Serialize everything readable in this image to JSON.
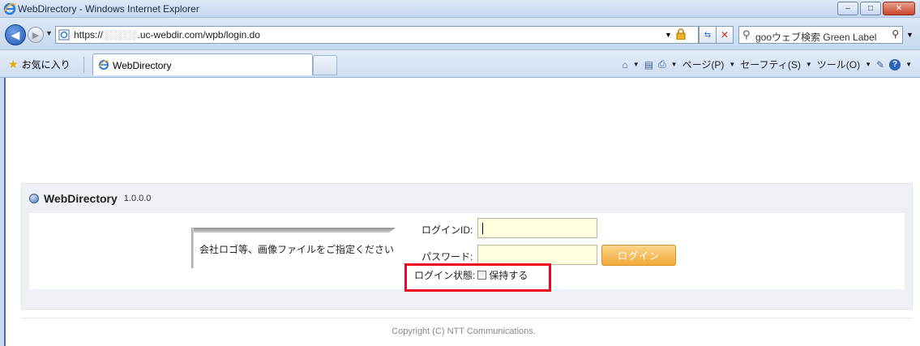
{
  "window": {
    "title": "WebDirectory - Windows Internet Explorer",
    "minimize_label": "–",
    "maximize_label": "□",
    "close_label": "✕"
  },
  "address_bar": {
    "url_prefix": "https://",
    "url_masked": "░░░░░",
    "url_rest": ".uc-webdir.com/wpb/login.do",
    "search_placeholder": "gooウェブ検索 Green Label"
  },
  "toolbar": {
    "favorites_label": "お気に入り",
    "tab_label": "WebDirectory",
    "page_menu": "ページ(P)",
    "safety_menu": "セーフティ(S)",
    "tools_menu": "ツール(O)"
  },
  "app": {
    "title": "WebDirectory",
    "version": "1.0.0.0",
    "logo_placeholder": "会社ロゴ等、画像ファイルをご指定ください",
    "login_id_label": "ログインID:",
    "password_label": "パスワード:",
    "login_button": "ログイン",
    "keep_login_label": "ログイン状態:",
    "keep_checkbox_label": "保持する",
    "copyright": "Copyright (C) NTT Communications."
  },
  "colors": {
    "highlight_border": "#f0051f",
    "login_button": "#f1a93a",
    "input_background": "#fefedf"
  }
}
